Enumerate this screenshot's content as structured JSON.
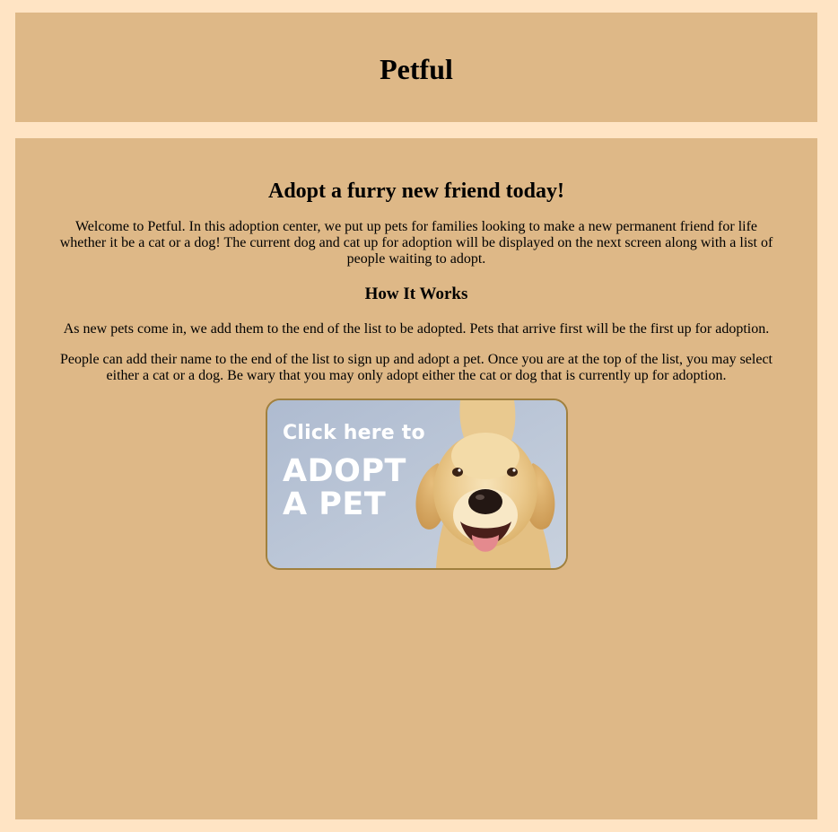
{
  "header": {
    "title": "Petful"
  },
  "main": {
    "heading": "Adopt a furry new friend today!",
    "intro": "Welcome to Petful. In this adoption center, we put up pets for families looking to make a new permanent friend for life whether it be a cat or a dog! The current dog and cat up for adoption will be displayed on the next screen along with a list of people waiting to adopt.",
    "how_it_works": {
      "title": "How It Works",
      "paragraphs": [
        "As new pets come in, we add them to the end of the list to be adopted. Pets that arrive first will be the first up for adoption.",
        "People can add their name to the end of the list to sign up and adopt a pet. Once you are at the top of the list, you may select either a cat or a dog. Be wary that you may only adopt either the cat or dog that is currently up for adoption."
      ]
    },
    "adopt_banner": {
      "line1": "Click here to",
      "line2": "ADOPT",
      "line3": "A PET",
      "image": "golden-retriever-dog-icon"
    }
  },
  "colors": {
    "page_background": "#FFE4C4",
    "panel_background": "#DEB887",
    "banner_border": "#A0803E",
    "banner_background": "#BCC8D8"
  }
}
